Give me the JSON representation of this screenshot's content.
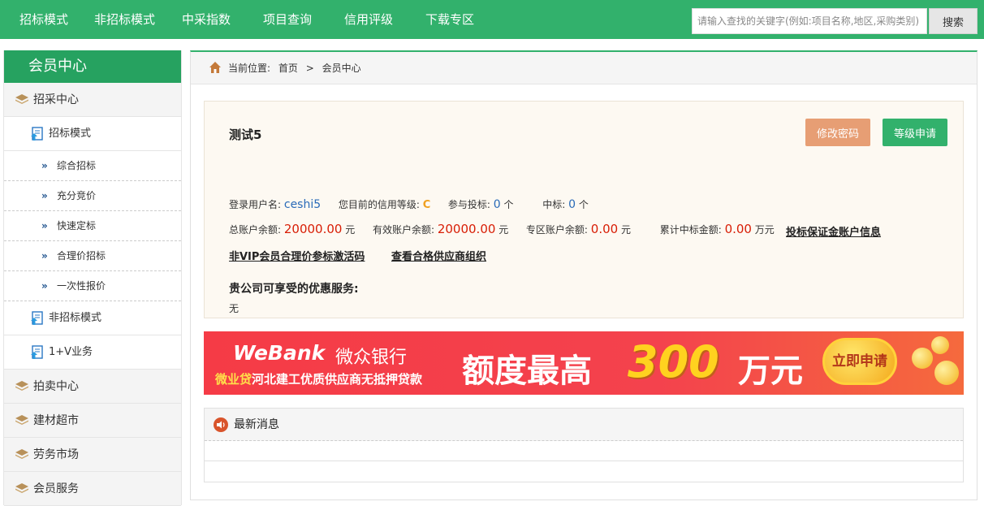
{
  "topnav": {
    "items": [
      "招标模式",
      "非招标模式",
      "中采指数",
      "项目查询",
      "信用评级",
      "下载专区"
    ],
    "search_placeholder": "请输入查找的关键字(例如:项目名称,地区,采购类别)",
    "search_button": "搜索"
  },
  "sidebar": {
    "title": "会员中心",
    "categories": {
      "procurement": "招采中心",
      "auction": "拍卖中心",
      "materials": "建材超市",
      "labor": "劳务市场",
      "member": "会员服务"
    },
    "subs": {
      "bidding": "招标模式",
      "non_bidding": "非招标模式",
      "one_v": "1+V业务"
    },
    "leaves": [
      "综合招标",
      "充分竞价",
      "快速定标",
      "合理价招标",
      "一次性报价"
    ]
  },
  "breadcrumb": {
    "label": "当前位置:",
    "home": "首页",
    "separator": ">",
    "current": "会员中心"
  },
  "account": {
    "name": "测试5",
    "change_password": "修改密码",
    "level_apply": "等级申请",
    "login_label": "登录用户名:",
    "login_value": "ceshi5",
    "credit_label": "您目前的信用等级:",
    "credit_value": "C",
    "bids_label": "参与投标:",
    "bids_value": "0",
    "bids_unit": "个",
    "won_label": "中标:",
    "won_value": "0",
    "won_unit": "个",
    "total_label": "总账户余额:",
    "total_value": "20000.00",
    "total_unit": "元",
    "valid_label": "有效账户余额:",
    "valid_value": "20000.00",
    "valid_unit": "元",
    "zone_label": "专区账户余额:",
    "zone_value": "0.00",
    "zone_unit": "元",
    "cum_label": "累计中标金额:",
    "cum_value": "0.00",
    "cum_unit": "万元",
    "deposit_link": "投标保证金账户信息",
    "activation_link": "非VIP会员合理价参标激活码",
    "suppliers_link": "查看合格供应商组织",
    "services_title": "贵公司可享受的优惠服务:",
    "services_value": "无"
  },
  "banner": {
    "brand": "WeBank",
    "brand_cn": "微众银行",
    "product": "微业贷",
    "subtitle": "河北建工优质供应商无抵押贷款",
    "headline": "额度最高",
    "amount": "300",
    "unit": "万元",
    "cta": "立即申请"
  },
  "news": {
    "title": "最新消息"
  }
}
